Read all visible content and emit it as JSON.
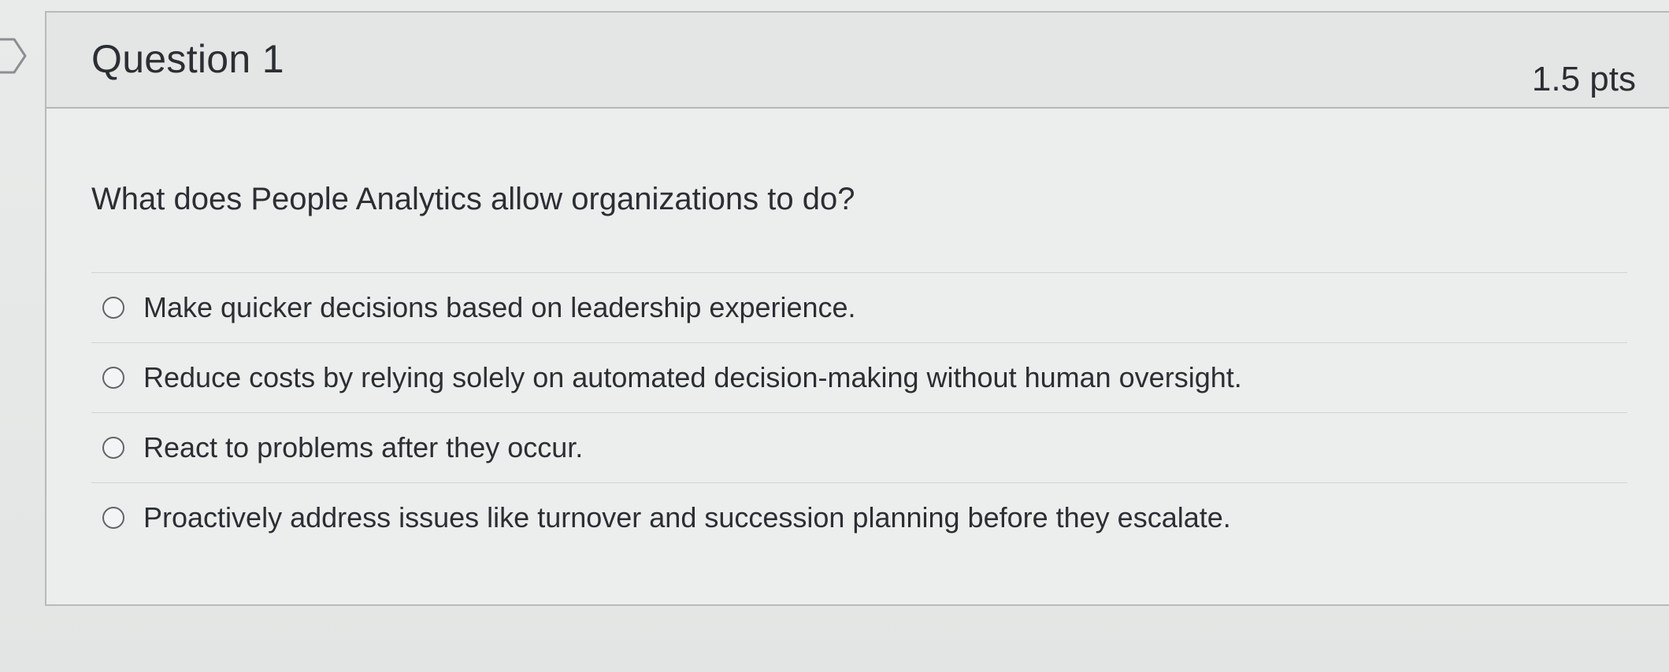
{
  "question": {
    "title": "Question 1",
    "points": "1.5 pts",
    "text": "What does People Analytics allow organizations to do?",
    "answers": [
      {
        "label": "Make quicker decisions based on leadership experience.",
        "selected": false
      },
      {
        "label": "Reduce costs by relying solely on automated decision-making without human oversight.",
        "selected": false
      },
      {
        "label": "React to problems after they occur.",
        "selected": false
      },
      {
        "label": "Proactively address issues like turnover and succession planning before they escalate.",
        "selected": false
      }
    ]
  },
  "icons": {
    "collapse": "chevron-right-icon",
    "radio": "radio-unchecked-icon"
  },
  "colors": {
    "text": "#2b2f33",
    "border": "#b6bab9",
    "card_background": "#eceeed"
  }
}
